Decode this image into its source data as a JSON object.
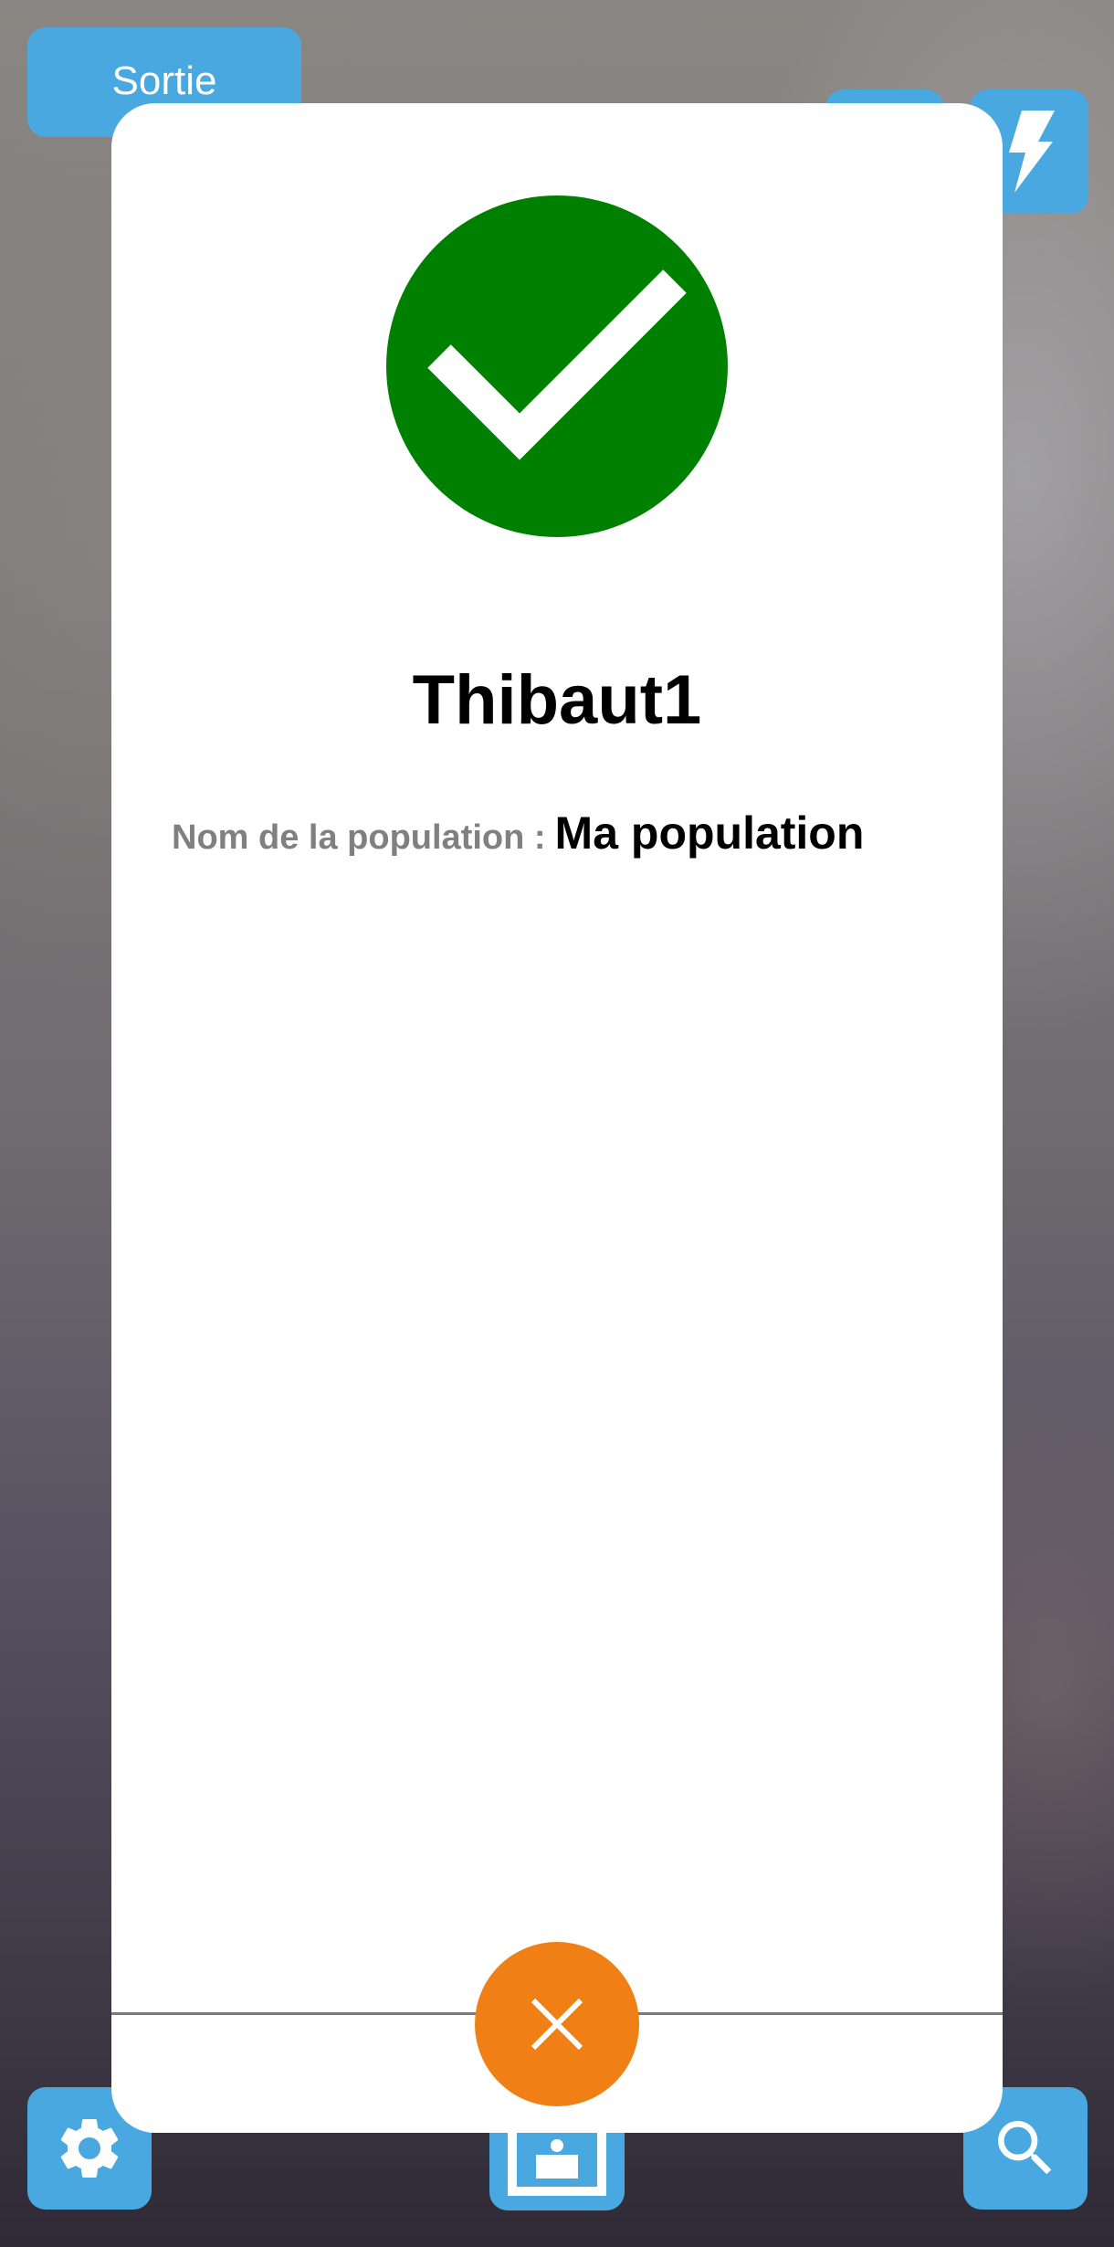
{
  "toolbar": {
    "exit_label": "Sortie"
  },
  "result": {
    "status_icon": "checkmark-circle-icon",
    "status_color": "#008000",
    "username": "Thibaut1",
    "population_label": "Nom de la population :",
    "population_value": "Ma population"
  },
  "colors": {
    "accent_blue": "#4aa8e0",
    "close_orange": "#f08015"
  },
  "icons": {
    "flash": "flash-icon",
    "settings": "gear-icon",
    "scan_frame": "scan-frame-icon",
    "search": "search-icon",
    "close": "close-icon"
  }
}
